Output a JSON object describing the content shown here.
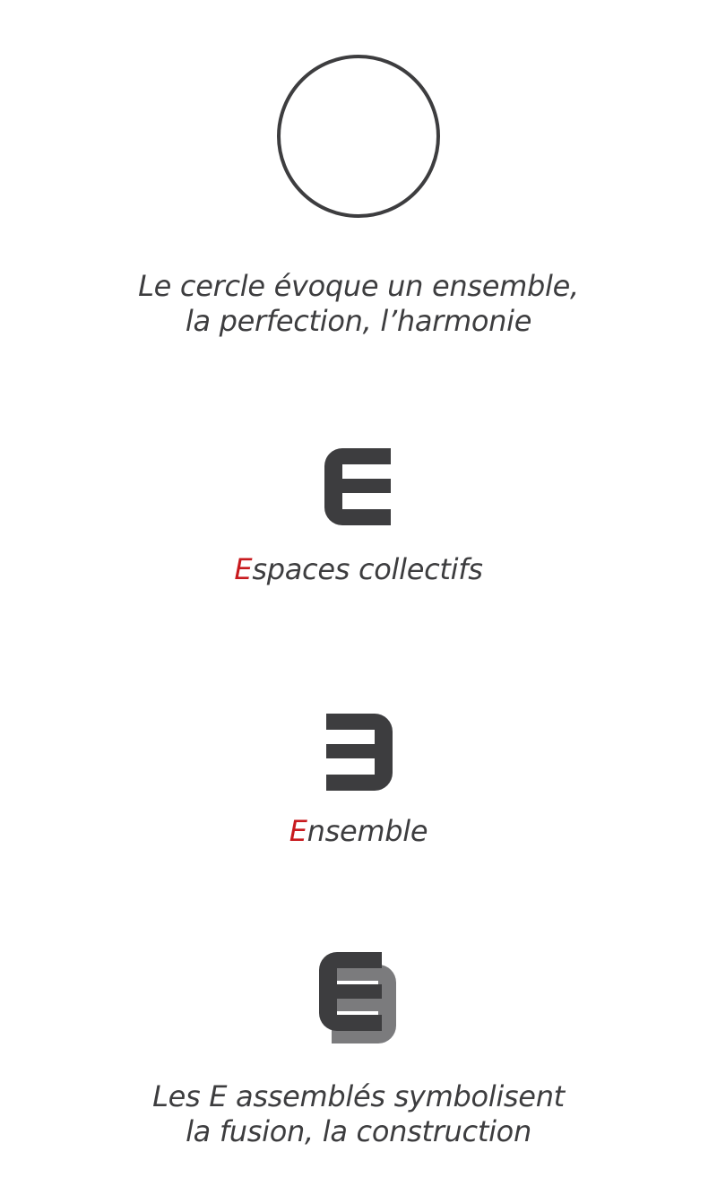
{
  "colors": {
    "dark_gray": "#3d3d3f",
    "mid_gray": "#7b7b7d",
    "accent_red": "#c81a1e",
    "background": "#ffffff"
  },
  "icons": [
    "circle-outline-icon",
    "letter-e-icon",
    "reversed-e-icon",
    "assembled-e-icon"
  ],
  "sections": {
    "circle": {
      "caption_line1": "Le cercle évoque un ensemble,",
      "caption_line2": "la perfection, l’harmonie"
    },
    "espaces": {
      "initial": "E",
      "rest": "spaces collectifs"
    },
    "ensemble": {
      "initial": "E",
      "rest": "nsemble"
    },
    "assembled": {
      "caption_line1": "Les E assemblés symbolisent",
      "caption_line2": "la fusion, la construction"
    }
  }
}
